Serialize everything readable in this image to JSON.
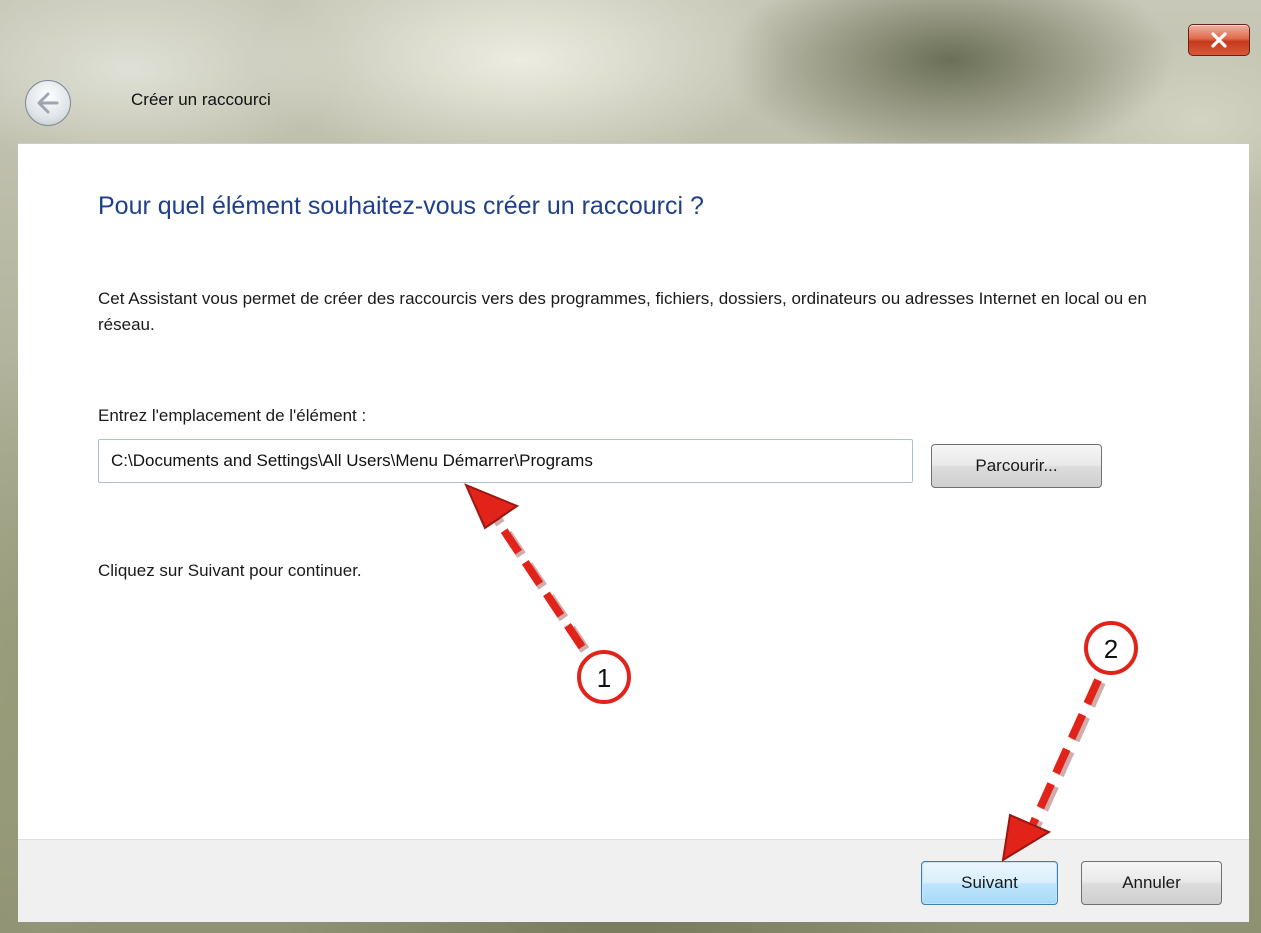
{
  "window": {
    "title": "Créer un raccourci",
    "close_icon": "close-icon",
    "back_icon": "back-arrow-icon"
  },
  "main": {
    "heading": "Pour quel élément souhaitez-vous créer un raccourci ?",
    "description": "Cet Assistant vous permet de créer des raccourcis vers des programmes, fichiers, dossiers, ordinateurs ou adresses Internet en local ou en réseau.",
    "field_label": "Entrez l'emplacement de l'élément :",
    "location_value": "C:\\Documents and Settings\\All Users\\Menu Démarrer\\Programs",
    "browse_label": "Parcourir...",
    "hint": "Cliquez sur Suivant pour continuer."
  },
  "footer": {
    "next_label": "Suivant",
    "cancel_label": "Annuler"
  },
  "annotations": {
    "callout_1": "1",
    "callout_2": "2",
    "arrow_color": "#e2231a"
  },
  "colors": {
    "heading": "#1e3f8a",
    "close_button": "#c7391c"
  }
}
